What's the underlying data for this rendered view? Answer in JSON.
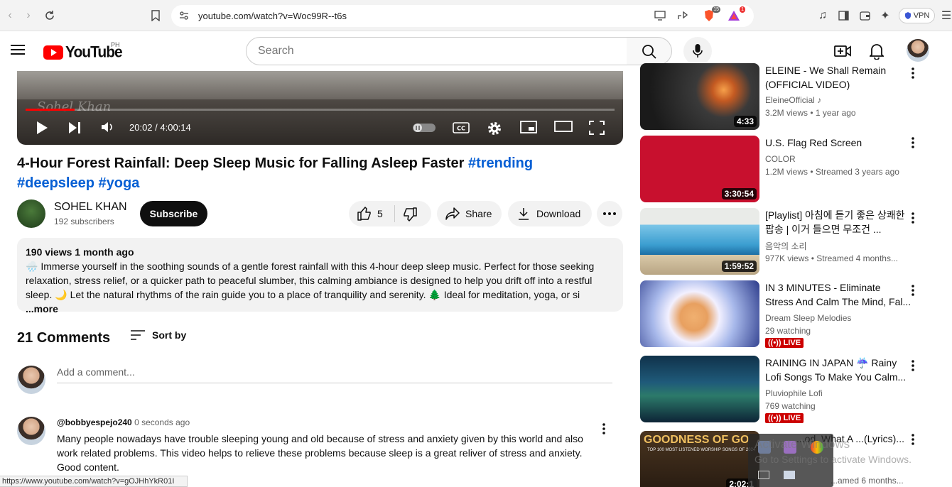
{
  "browser": {
    "url": "youtube.com/watch?v=Woc99R--t6s",
    "brave_badge": "15",
    "alert_badge": "1",
    "vpn_label": "VPN",
    "status_url": "https://www.youtube.com/watch?v=gOJHhYkR01I"
  },
  "header": {
    "logo_text": "YouTube",
    "country_code": "PH",
    "search_placeholder": "Search"
  },
  "player": {
    "time": "20:02 / 4:00:14",
    "progress": 0.0834,
    "watermark": "Sohel Khan"
  },
  "video": {
    "title_main": "4-Hour Forest Rainfall: Deep Sleep Music for Falling Asleep Faster ",
    "tag1": "#trending",
    "tag2": "#deepsleep",
    "tag3": "#yoga",
    "channel_name": "SOHEL KHAN",
    "subscribers": "192 subscribers",
    "subscribe_label": "Subscribe",
    "likes": "5",
    "share_label": "Share",
    "download_label": "Download"
  },
  "description": {
    "meta": "190 views  1 month ago",
    "text": "🌧️ Immerse yourself in the soothing sounds of a gentle forest rainfall with this 4-hour deep sleep music. Perfect for those seeking relaxation, stress relief, or a quicker path to peaceful slumber, this calming ambiance is designed to help you drift off into a restful sleep. 🌙 Let the natural rhythms of the rain guide you to a place of tranquility and serenity. 🌲 Ideal for meditation, yoga, or si",
    "more": "...more"
  },
  "comments": {
    "count": "21 Comments",
    "sort_label": "Sort by",
    "add_placeholder": "Add a comment...",
    "items": [
      {
        "user": "@bobbyespejo240",
        "time": "0 seconds ago",
        "text": "Many people nowadays have trouble sleeping young and old because of stress and anxiety given by this world and also work related problems. This video helps to relieve these problems because sleep is a great reliver of stress and anxiety. Good content."
      }
    ]
  },
  "sidebar": {
    "items": [
      {
        "title": "ELEINE - We Shall Remain (OFFICIAL VIDEO)",
        "channel": "EleineOfficial ♪",
        "stats": "3.2M views  • 1 year ago",
        "duration": "4:33"
      },
      {
        "title": "U.S. Flag Red Screen",
        "channel": "COLOR",
        "stats": "1.2M views  • Streamed 3 years ago",
        "duration": "3:30:54"
      },
      {
        "title": "[Playlist] 아침에 듣기 좋은 상쾌한 팝송 | 이거 들으면 무조건 ...",
        "channel": "음악의 소리",
        "stats": "977K views  • Streamed 4 months...",
        "duration": "1:59:52"
      },
      {
        "title": "IN 3 MINUTES - Eliminate Stress And Calm The Mind, Fal...",
        "channel": "Dream Sleep Melodies",
        "stats": "29 watching",
        "live": "LIVE"
      },
      {
        "title": "RAINING IN JAPAN ☔ Rainy Lofi Songs To Make You Calm...",
        "channel": "Pluviophile Lofi",
        "stats": "769 watching",
        "live": "LIVE"
      },
      {
        "title": "...od, What A ...(Lyrics)...",
        "channel": "",
        "stats": "...amed 6 months...",
        "thumb_text": "GOODNESS OF GO",
        "thumb_sub": "TOP 100 MOST LISTENED WORSHIP SONGS OF 2024",
        "duration": "2:02:1"
      }
    ]
  },
  "watermark": {
    "line1": "Activate Windows",
    "line2": "Go to Settings to activate Windows."
  },
  "colors": {
    "accent": "#065fd4",
    "brand": "#ff0000",
    "live": "#cc0000"
  }
}
